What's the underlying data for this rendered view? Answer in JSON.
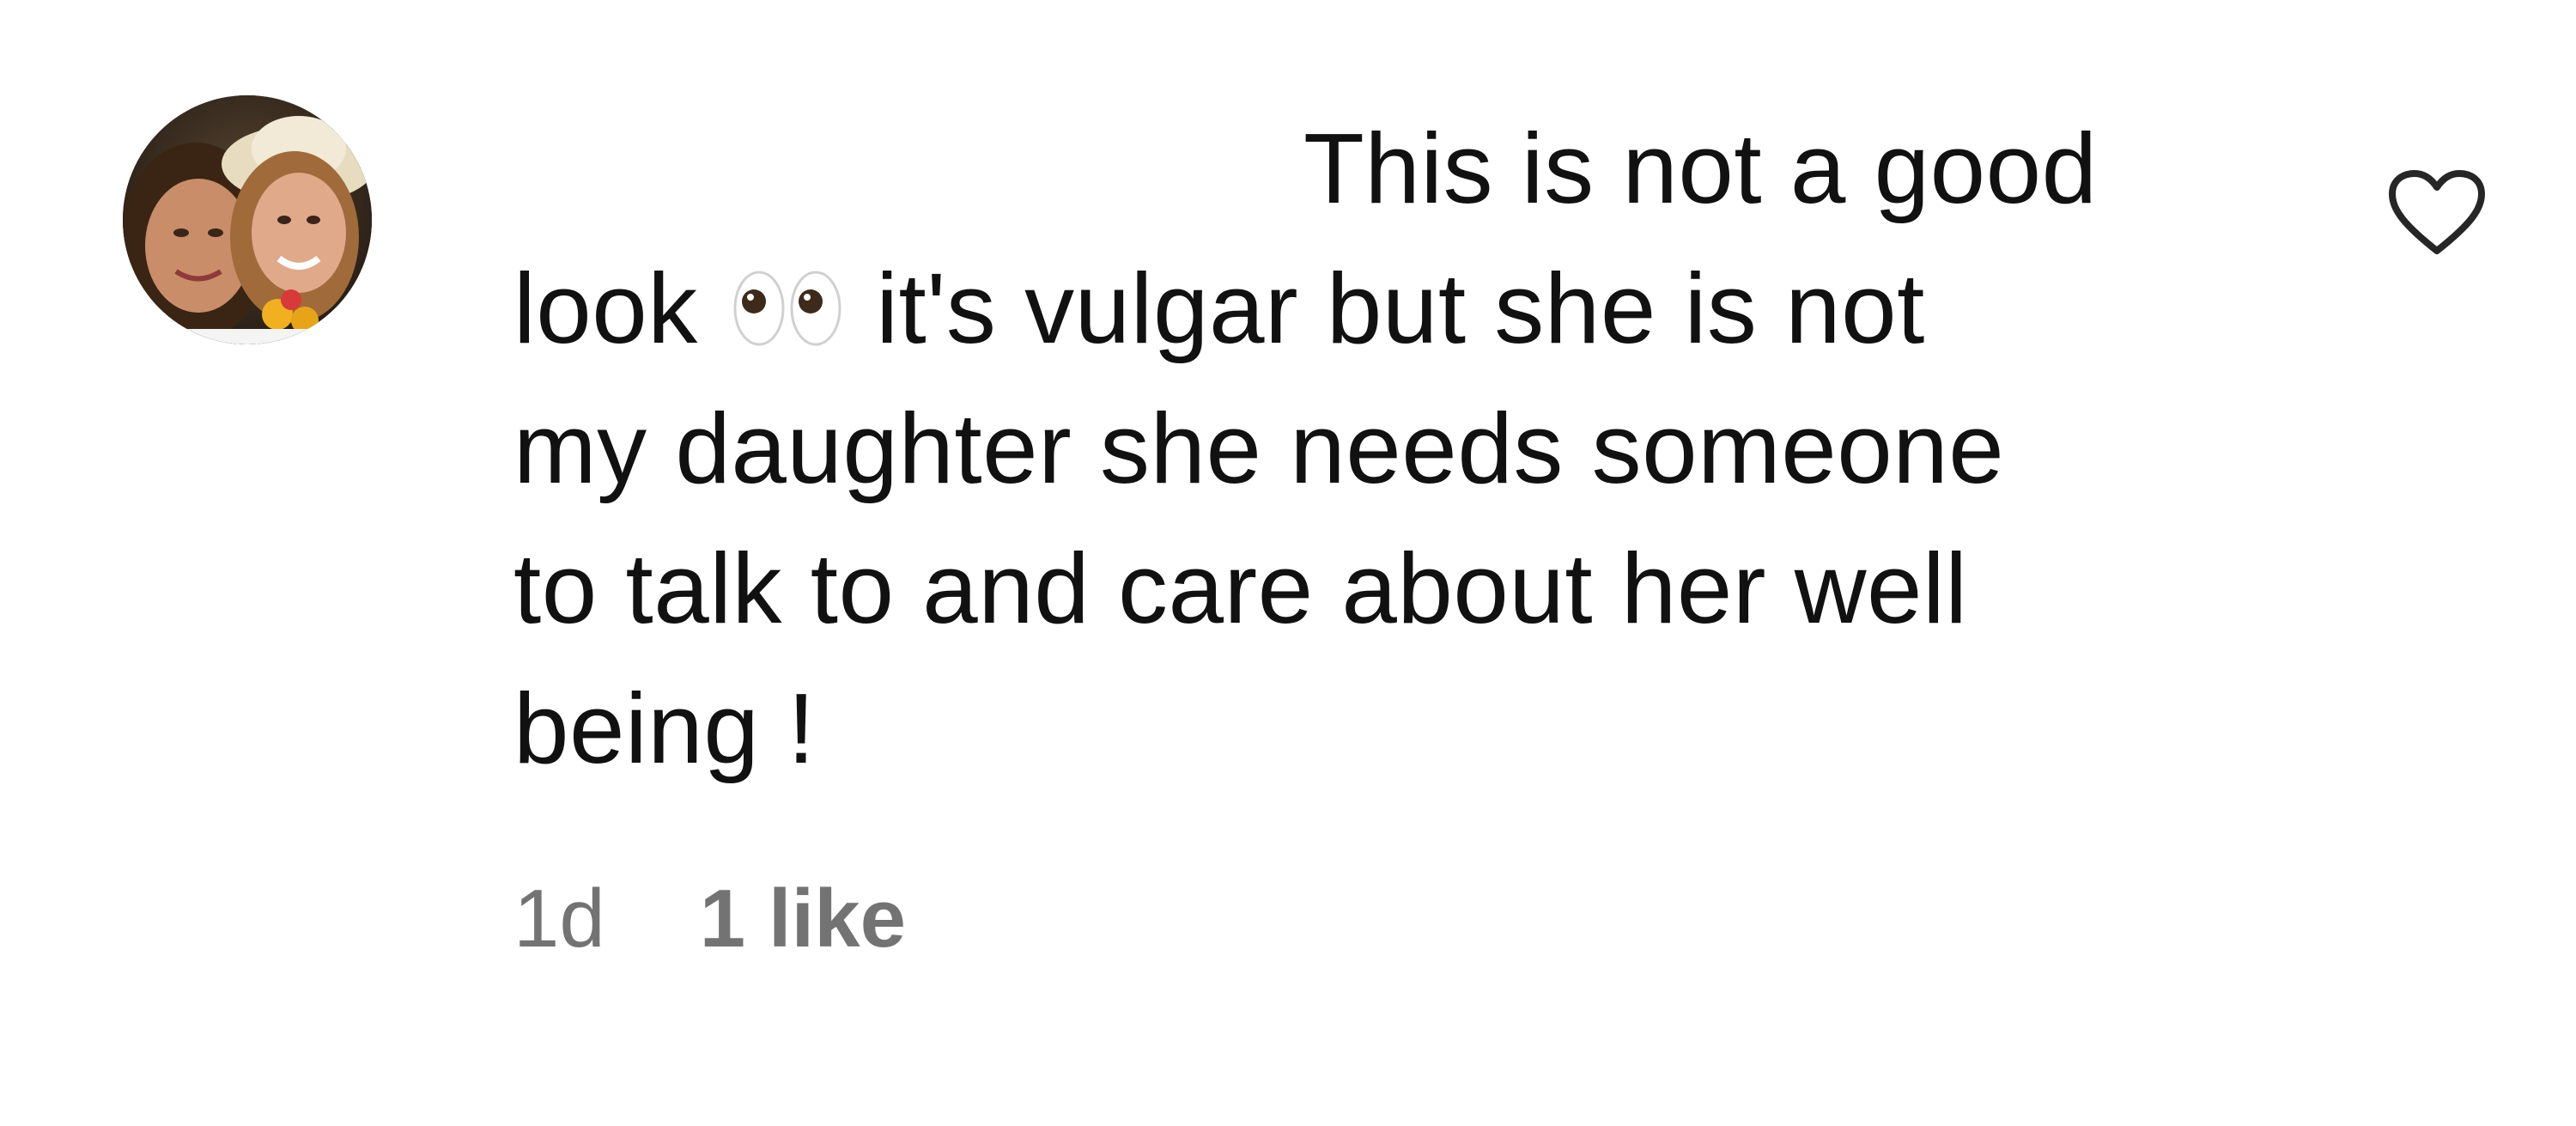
{
  "comment": {
    "avatar": {
      "icon": "user-avatar-photo",
      "label": "profile photo"
    },
    "text_lines": [
      "This is not a good",
      "it's vulgar but she is not",
      "my daughter she needs someone",
      "to talk to and care about her well",
      "being !"
    ],
    "line2_prefix": "look",
    "emoji": "👀",
    "timestamp": "1d",
    "likes_label": "1 like",
    "like_icon": "heart-outline-icon",
    "colors": {
      "text": "#111111",
      "meta": "#737373",
      "background": "#ffffff"
    }
  }
}
